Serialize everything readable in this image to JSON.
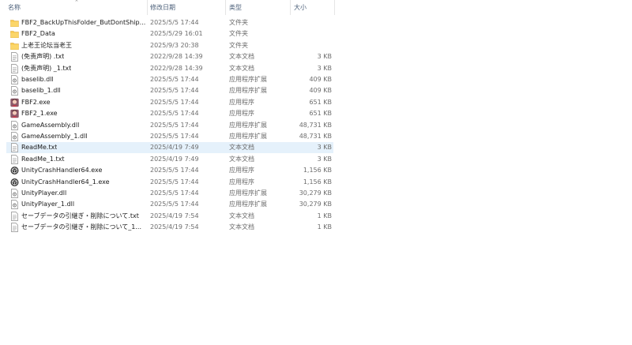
{
  "columns": {
    "name": "名称",
    "date": "修改日期",
    "type": "类型",
    "size": "大小"
  },
  "rows": [
    {
      "name": "FBF2_BackUpThisFolder_ButDontShip...",
      "date": "2025/5/5 17:44",
      "type": "文件夹",
      "size": "",
      "icon": "folder-icon"
    },
    {
      "name": "FBF2_Data",
      "date": "2025/5/29 16:01",
      "type": "文件夹",
      "size": "",
      "icon": "folder-icon"
    },
    {
      "name": "上老王论坛当老王",
      "date": "2025/9/3 20:38",
      "type": "文件夹",
      "size": "",
      "icon": "folder-icon"
    },
    {
      "name": "(免责声明) .txt",
      "date": "2022/9/28 14:39",
      "type": "文本文档",
      "size": "3 KB",
      "icon": "text-file-icon"
    },
    {
      "name": "(免责声明) _1.txt",
      "date": "2022/9/28 14:39",
      "type": "文本文档",
      "size": "3 KB",
      "icon": "text-file-icon"
    },
    {
      "name": "baselib.dll",
      "date": "2025/5/5 17:44",
      "type": "应用程序扩展",
      "size": "409 KB",
      "icon": "dll-file-icon"
    },
    {
      "name": "baselib_1.dll",
      "date": "2025/5/5 17:44",
      "type": "应用程序扩展",
      "size": "409 KB",
      "icon": "dll-file-icon"
    },
    {
      "name": "FBF2.exe",
      "date": "2025/5/5 17:44",
      "type": "应用程序",
      "size": "651 KB",
      "icon": "game-app-icon"
    },
    {
      "name": "FBF2_1.exe",
      "date": "2025/5/5 17:44",
      "type": "应用程序",
      "size": "651 KB",
      "icon": "game-app-icon"
    },
    {
      "name": "GameAssembly.dll",
      "date": "2025/5/5 17:44",
      "type": "应用程序扩展",
      "size": "48,731 KB",
      "icon": "dll-file-icon"
    },
    {
      "name": "GameAssembly_1.dll",
      "date": "2025/5/5 17:44",
      "type": "应用程序扩展",
      "size": "48,731 KB",
      "icon": "dll-file-icon"
    },
    {
      "name": "ReadMe.txt",
      "date": "2025/4/19 7:49",
      "type": "文本文档",
      "size": "3 KB",
      "icon": "text-file-icon",
      "selected": true
    },
    {
      "name": "ReadMe_1.txt",
      "date": "2025/4/19 7:49",
      "type": "文本文档",
      "size": "3 KB",
      "icon": "text-file-icon"
    },
    {
      "name": "UnityCrashHandler64.exe",
      "date": "2025/5/5 17:44",
      "type": "应用程序",
      "size": "1,156 KB",
      "icon": "unity-app-icon"
    },
    {
      "name": "UnityCrashHandler64_1.exe",
      "date": "2025/5/5 17:44",
      "type": "应用程序",
      "size": "1,156 KB",
      "icon": "unity-app-icon"
    },
    {
      "name": "UnityPlayer.dll",
      "date": "2025/5/5 17:44",
      "type": "应用程序扩展",
      "size": "30,279 KB",
      "icon": "dll-file-icon"
    },
    {
      "name": "UnityPlayer_1.dll",
      "date": "2025/5/5 17:44",
      "type": "应用程序扩展",
      "size": "30,279 KB",
      "icon": "dll-file-icon"
    },
    {
      "name": "セーブデータの引継ぎ・削除について.txt",
      "date": "2025/4/19 7:54",
      "type": "文本文档",
      "size": "1 KB",
      "icon": "text-file-icon"
    },
    {
      "name": "セーブデータの引継ぎ・削除について_1...",
      "date": "2025/4/19 7:54",
      "type": "文本文档",
      "size": "1 KB",
      "icon": "text-file-icon"
    }
  ],
  "colors": {
    "header_text": "#4c607a",
    "selected_row": "#e5f1fb",
    "folder": "#f8c94c",
    "secondary_text": "#6d6d6d"
  }
}
